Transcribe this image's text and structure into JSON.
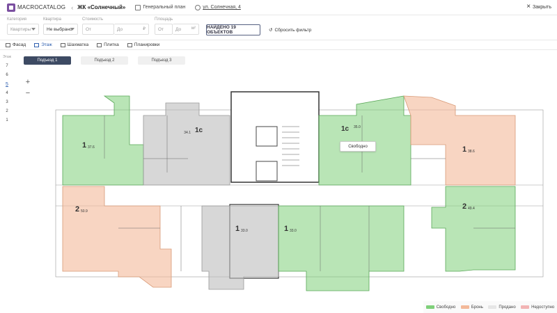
{
  "topbar": {
    "logo_text": "MACROCATALOG",
    "back": "‹",
    "project": "ЖК «Солнечный»",
    "masterplan": "Генеральный план",
    "address": "ул. Солнечная, 4",
    "close": "Закрыть"
  },
  "filters": {
    "category": {
      "label": "Категория",
      "placeholder": "Квартиры"
    },
    "apartment": {
      "label": "Квартира",
      "value": "Не выбрано"
    },
    "price": {
      "label": "Стоимость",
      "from": "От",
      "to": "До",
      "unit": "₽"
    },
    "area": {
      "label": "Площадь",
      "from": "От",
      "to": "До",
      "unit": "м²"
    },
    "found": "НАЙДЕНО 19 ОБЪЕКТОВ",
    "reset": "Сбросить фильтр"
  },
  "views": [
    {
      "label": "Фасад"
    },
    {
      "label": "Этаж",
      "active": true
    },
    {
      "label": "Шахматка"
    },
    {
      "label": "Плитка"
    },
    {
      "label": "Планировки"
    }
  ],
  "floors": {
    "header": "Этаж",
    "items": [
      "7",
      "6",
      "5",
      "4",
      "3",
      "2",
      "1"
    ],
    "active": "5"
  },
  "entrances": [
    "Подъезд 1",
    "Подъезд 2",
    "Подъезд 3"
  ],
  "zoom": {
    "plus": "+",
    "minus": "−"
  },
  "tooltip": "Свободно",
  "apartments": [
    {
      "rooms": "1",
      "area": "37.6",
      "status": "free"
    },
    {
      "rooms": "1c",
      "area": "34.1",
      "status": "sold"
    },
    {
      "rooms": "1c",
      "area": "35.0",
      "status": "free"
    },
    {
      "rooms": "1",
      "area": "38.6",
      "status": "booked"
    },
    {
      "rooms": "2",
      "area": "50.9",
      "status": "booked"
    },
    {
      "rooms": "1",
      "area": "33.0",
      "status": "sold"
    },
    {
      "rooms": "1",
      "area": "33.0",
      "status": "free"
    },
    {
      "rooms": "2",
      "area": "49.4",
      "status": "free"
    }
  ],
  "legend": {
    "free": "Свободно",
    "booked": "Бронь",
    "sold": "Продано",
    "unavailable": "Недоступно"
  },
  "colors": {
    "free": "#7fd07a",
    "booked": "#f3b999",
    "sold": "#bdbdbd",
    "unavailable": "#f2b4b4",
    "accent": "#3060b0"
  }
}
